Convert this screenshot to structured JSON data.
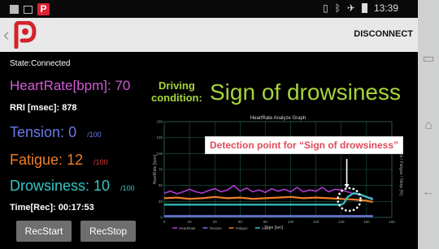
{
  "statusbar": {
    "time": "13:39"
  },
  "actionbar": {
    "logo_letter": "P",
    "disconnect_label": "DISCONNECT"
  },
  "state": {
    "text": "State:Connected"
  },
  "metrics": {
    "heart_rate_label": "HeartRate[bpm]:",
    "heart_rate_value": "70",
    "rri_label": "RRI [msec]:",
    "rri_value": "878",
    "tension_label": "Tension:",
    "tension_value": "0",
    "tension_max": "/100",
    "fatigue_label": "Fatigue:",
    "fatigue_value": "12",
    "fatigue_max": "/100",
    "drowsiness_label": "Drowsiness:",
    "drowsiness_value": "10",
    "drowsiness_max": "/100",
    "time_label": "Time[Rec]:",
    "time_value": "00:17:53"
  },
  "buttons": {
    "rec_start": "RecStart",
    "rec_stop": "RecStop"
  },
  "condition": {
    "label_line1": "Driving",
    "label_line2": "condition:",
    "value": "Sign of drowsiness"
  },
  "annotation": {
    "detection_text": "Detection point for “Sign of drowsiness”"
  },
  "colors": {
    "heart_rate": "#d35ad6",
    "tension": "#6a7ae8",
    "fatigue": "#f07d28",
    "drowsiness": "#35c6c6",
    "condition": "#a6d53a",
    "detection": "#e04b5a"
  },
  "chart_data": {
    "type": "line",
    "title": "HeartRate Analyze Graph",
    "xlabel": "Time [sec]",
    "ylabel": "HeartRate [bpm]",
    "y2label": "Tension / Fatigue / Sleep [%]",
    "xlim": [
      0,
      180
    ],
    "ylim": [
      0,
      150
    ],
    "xticks": [
      "0",
      "20",
      "40",
      "60",
      "80",
      "100",
      "120",
      "140",
      "160",
      "180"
    ],
    "yticks": [
      "0",
      "25",
      "50",
      "75",
      "100",
      "125",
      "150"
    ],
    "legend": [
      "HeartRate",
      "Tension",
      "Fatigue",
      "Sleep"
    ],
    "grid": true,
    "series": [
      {
        "name": "HeartRate",
        "color": "#b03bd2",
        "x": [
          0,
          5,
          10,
          15,
          20,
          25,
          30,
          35,
          40,
          45,
          50,
          55,
          60,
          65,
          70,
          75,
          80,
          85,
          90,
          95,
          100,
          105,
          110,
          115,
          120,
          125,
          130,
          135,
          140,
          145,
          150,
          155,
          160,
          165
        ],
        "y": [
          38,
          41,
          37,
          40,
          44,
          40,
          38,
          42,
          45,
          40,
          43,
          50,
          41,
          46,
          40,
          43,
          39,
          45,
          41,
          44,
          40,
          47,
          40,
          43,
          41,
          47,
          40,
          44,
          43,
          40,
          37,
          35,
          32,
          30
        ]
      },
      {
        "name": "Tension",
        "color": "#6a7ae8",
        "x": [
          0,
          20,
          40,
          60,
          80,
          100,
          120,
          140,
          160,
          165
        ],
        "y": [
          2,
          2,
          2,
          2,
          2,
          2,
          2,
          2,
          2,
          2
        ]
      },
      {
        "name": "Fatigue",
        "color": "#f07d28",
        "x": [
          0,
          10,
          20,
          30,
          40,
          50,
          60,
          70,
          80,
          90,
          100,
          110,
          120,
          130,
          140,
          150,
          160,
          165
        ],
        "y": [
          30,
          31,
          29,
          30,
          32,
          30,
          31,
          29,
          30,
          31,
          32,
          30,
          31,
          30,
          29,
          28,
          26,
          24
        ]
      },
      {
        "name": "Sleep",
        "color": "#35c6c6",
        "x": [
          0,
          20,
          40,
          60,
          80,
          100,
          120,
          140,
          142,
          145,
          150,
          155,
          160,
          165
        ],
        "y": [
          20,
          20,
          20,
          20,
          20,
          20,
          20,
          20,
          22,
          32,
          38,
          36,
          32,
          28
        ]
      }
    ],
    "highlight_x": 145
  }
}
